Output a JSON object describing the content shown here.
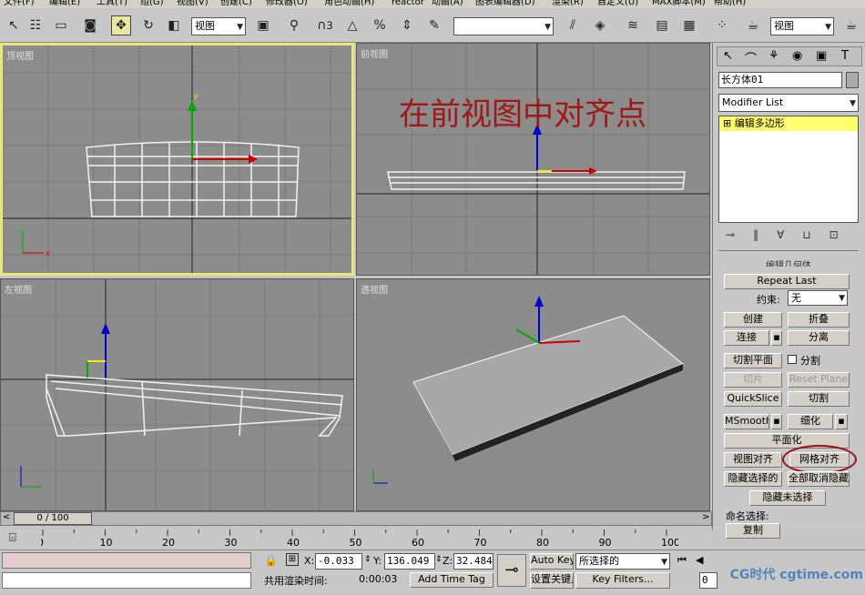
{
  "menu": [
    "文件(F)",
    "编辑(E)",
    "工具(T)",
    "组(G)",
    "视图(V)",
    "创建(C)",
    "修改器(O)",
    "角色动画(H)",
    "reactor",
    "动画(A)",
    "图表编辑器(D)",
    "渲染(R)",
    "自定义(U)",
    "MAX脚本(M)",
    "帮助(H)"
  ],
  "toolbar": {
    "view_select": "视图",
    "view_select2": "视图",
    "snap_num": "3",
    "percent": "%"
  },
  "viewports": {
    "top": "顶视图",
    "front": "前视图",
    "left": "左视图",
    "persp": "透视图",
    "front_annotation": "在前视图中对齐点"
  },
  "command_panel": {
    "object_name": "长方体01",
    "modifier_list": "Modifier List",
    "stack_item": "编辑多边形",
    "rollout_title": "编辑几何体",
    "repeat_last": "Repeat Last",
    "constraint_label": "约束:",
    "constraint_value": "无",
    "create": "创建",
    "collapse": "折叠",
    "attach": "连接",
    "detach": "分离",
    "slice_plane": "切割平面",
    "split": "分割",
    "slice": "切片",
    "reset_plane": "Reset Plane",
    "quickslice": "QuickSlice",
    "cut": "切割",
    "msmooth": "MSmooth",
    "tessellate": "细化",
    "make_planar": "平面化",
    "view_align": "视图对齐",
    "grid_align": "网格对齐",
    "hide_selected": "隐藏选择的",
    "unhide_all": "全部取消隐藏",
    "hide_unselected": "隐藏未选择",
    "named_sel": "命名选择:",
    "copy": "复制"
  },
  "timeline": {
    "frame": "0 / 100",
    "ticks": [
      "0",
      "10",
      "20",
      "30",
      "40",
      "50",
      "60",
      "70",
      "80",
      "90",
      "100"
    ]
  },
  "status": {
    "x_label": "X:",
    "x_value": "-0.033",
    "y_label": "Y:",
    "y_value": "136.049",
    "z_label": "Z:",
    "z_value": "32.484",
    "auto_key": "Auto Key",
    "selected": "所选择的",
    "set_key": "设置关键点",
    "key_filters": "Key Filters...",
    "render_time_label": "共用渲染时间:",
    "render_time": "0:00:03",
    "add_time_tag": "Add Time Tag",
    "frame_field": "0"
  },
  "watermark": "CG时代 cgtime.com"
}
